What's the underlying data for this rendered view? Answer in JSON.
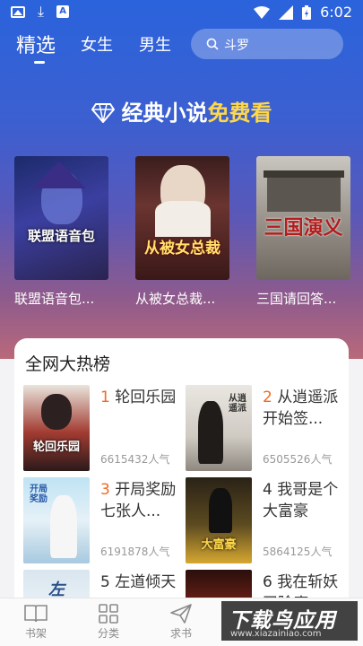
{
  "status_bar": {
    "time": "6:02"
  },
  "header": {
    "tabs": [
      {
        "label": "精选"
      },
      {
        "label": "女生"
      },
      {
        "label": "男生"
      }
    ],
    "search_placeholder": "斗罗"
  },
  "banner": {
    "title_part1": "经典小说",
    "title_part2": "免费看"
  },
  "featured_books": [
    {
      "title": "联盟语音包...",
      "cover_text": "联盟语音包"
    },
    {
      "title": "从被女总裁...",
      "cover_text": "从被女总裁"
    },
    {
      "title": "三国请回答...",
      "cover_text": "三国演义"
    }
  ],
  "hot_list": {
    "title": "全网大热榜",
    "items": [
      {
        "rank": "1",
        "name": "轮回乐园",
        "popularity": "6615432人气",
        "cover_text": "轮回乐园"
      },
      {
        "rank": "2",
        "name": "从逍遥派开始签...",
        "popularity": "6505526人气",
        "cover_text": "从逍遥派"
      },
      {
        "rank": "3",
        "name": "开局奖励七张人...",
        "popularity": "6191878人气",
        "cover_text": "开局奖励"
      },
      {
        "rank": "4",
        "name": "我哥是个大富豪",
        "popularity": "5864125人气",
        "cover_text": "大富豪"
      },
      {
        "rank": "5",
        "name": "左道倾天",
        "popularity": "",
        "cover_text": "左"
      },
      {
        "rank": "6",
        "name": "我在斩妖司除魔",
        "popularity": "",
        "cover_text": ""
      }
    ]
  },
  "bottom_nav": [
    {
      "label": "书架"
    },
    {
      "label": "分类"
    },
    {
      "label": "求书"
    }
  ],
  "watermark": {
    "main": "下载鸟应用",
    "sub": "www.xiazainiao.com"
  }
}
